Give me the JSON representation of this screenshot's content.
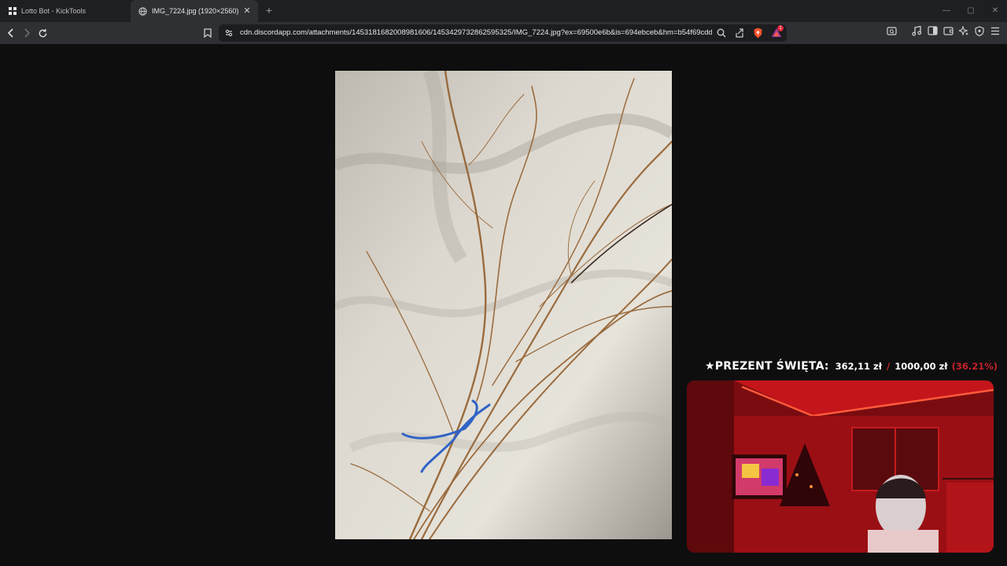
{
  "tabs": [
    {
      "title": "Lotto Bot - KickTools",
      "icon": "grid-icon",
      "active": false
    },
    {
      "title": "IMG_7224.jpg (1920×2560)",
      "icon": "globe-icon",
      "active": true
    }
  ],
  "new_tab_label": "+",
  "window_controls": {
    "minimize": "—",
    "maximize": "▢",
    "close": "✕"
  },
  "url": "cdn.discordapp.com/attachments/1453181682008981606/1453429732862595325/IMG_7224.jpg?ex=69500e6b&is=694ebceb&hm=b54f69cdd...",
  "brave_badge_count": "1",
  "overlay": {
    "goal_title": "★PREZENT ŚWIĘTA:",
    "goal_current": "362,11 zł",
    "goal_separator": "/",
    "goal_target": "1000,00 zł",
    "goal_percent": "(36.21%)",
    "goal_progress": 0.3621
  },
  "colors": {
    "tabstrip_bg": "#1e1f22",
    "toolbar_bg": "#2e3034",
    "page_bg": "#0e0e0f",
    "brave_orange": "#fb542b",
    "goal_accent": "#c8222a"
  }
}
